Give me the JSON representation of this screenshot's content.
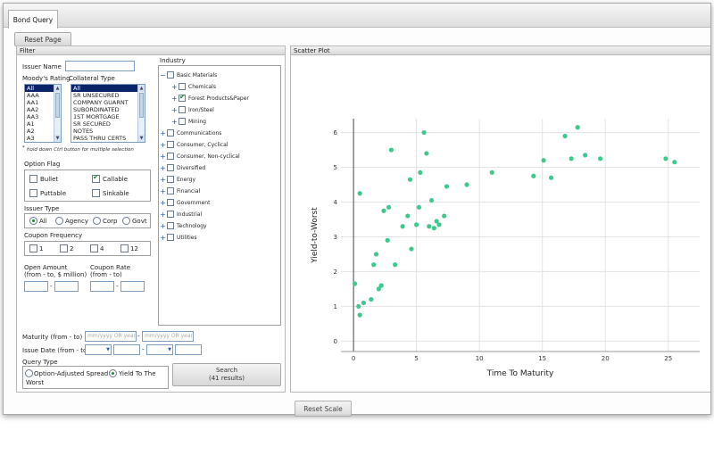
{
  "tabs": [
    {
      "label": "Bond Query"
    }
  ],
  "reset_page_label": "Reset Page",
  "filter": {
    "title": "Filter",
    "issuer_name_label": "Issuer Name",
    "moodys_label": "Moody's Rating",
    "moodys_options": [
      "All",
      "AAA",
      "AA1",
      "AA2",
      "AA3",
      "A1",
      "A2",
      "A3"
    ],
    "collateral_label": "Collateral Type",
    "collateral_options": [
      "All",
      "SR UNSECURED",
      "COMPANY GUARNT",
      "SUBORDINATED",
      "1ST MORTGAGE",
      "SR SECURED",
      "NOTES",
      "PASS THRU CERTS"
    ],
    "hint_mark": "*",
    "hint": "hold down Ctrl button for multiple selection",
    "option_flag_label": "Option Flag",
    "option_flags": [
      {
        "label": "Bullet",
        "checked": false
      },
      {
        "label": "Callable",
        "checked": true
      },
      {
        "label": "Puttable",
        "checked": false
      },
      {
        "label": "Sinkable",
        "checked": false
      }
    ],
    "issuer_type_label": "Issuer Type",
    "issuer_types": [
      {
        "label": "All",
        "selected": true
      },
      {
        "label": "Agency",
        "selected": false
      },
      {
        "label": "Corp",
        "selected": false
      },
      {
        "label": "Govt",
        "selected": false
      }
    ],
    "coupon_freq_label": "Coupon Frequency",
    "coupon_freqs": [
      "1",
      "2",
      "4",
      "12"
    ],
    "open_amount_label1": "Open Amount",
    "open_amount_label2": "(from - to, $ million)",
    "coupon_rate_label1": "Coupon Rate",
    "coupon_rate_label2": "(from - to)",
    "range_dash": "-",
    "maturity_label": "Maturity (from - to)",
    "date_placeholder": "mm/yyyy OR year",
    "issue_date_label": "Issue Date (from - to)",
    "query_type_label": "Query Type",
    "query_types": [
      {
        "label": "Option-Adjusted Spread",
        "selected": false
      },
      {
        "label": "Yield To The",
        "selected": true
      }
    ],
    "query_type_wrap": "Worst",
    "search_label": "Search",
    "search_results": "(41 results)"
  },
  "industry": {
    "label": "Industry",
    "items": [
      {
        "label": "Basic Materials",
        "expander": "−",
        "level": 0,
        "checked": false
      },
      {
        "label": "Chemicals",
        "expander": "+",
        "level": 1,
        "checked": false
      },
      {
        "label": "Forest Products&Paper",
        "expander": "+",
        "level": 1,
        "checked": true
      },
      {
        "label": "Iron/Steel",
        "expander": "+",
        "level": 1,
        "checked": false
      },
      {
        "label": "Mining",
        "expander": "+",
        "level": 1,
        "checked": false
      },
      {
        "label": "Communications",
        "expander": "+",
        "level": 0,
        "checked": false
      },
      {
        "label": "Consumer, Cyclical",
        "expander": "+",
        "level": 0,
        "checked": false
      },
      {
        "label": "Consumer, Non-cyclical",
        "expander": "+",
        "level": 0,
        "checked": false
      },
      {
        "label": "Diversified",
        "expander": "+",
        "level": 0,
        "checked": false
      },
      {
        "label": "Energy",
        "expander": "+",
        "level": 0,
        "checked": false
      },
      {
        "label": "Financial",
        "expander": "+",
        "level": 0,
        "checked": false
      },
      {
        "label": "Government",
        "expander": "+",
        "level": 0,
        "checked": false
      },
      {
        "label": "Industrial",
        "expander": "+",
        "level": 0,
        "checked": false
      },
      {
        "label": "Technology",
        "expander": "+",
        "level": 0,
        "checked": false
      },
      {
        "label": "Utilities",
        "expander": "+",
        "level": 0,
        "checked": false
      }
    ]
  },
  "scatter": {
    "title": "Scatter Plot",
    "reset_scale_label": "Reset Scale"
  },
  "colors": {
    "point": "#3cc98b",
    "accent_check": "#1c8a2c"
  },
  "chart_data": {
    "type": "scatter",
    "title": "",
    "xlabel": "Time To Maturity",
    "ylabel": "Yield-to-Worst",
    "xlim": [
      -1,
      27.5
    ],
    "ylim": [
      -0.3,
      6.4
    ],
    "xticks": [
      0,
      5,
      10,
      15,
      20,
      25
    ],
    "yticks": [
      0,
      1,
      2,
      3,
      4,
      5,
      6
    ],
    "grid": true,
    "series": [
      {
        "x": [
          0.1,
          0.4,
          0.5,
          0.5,
          0.8,
          1.4,
          1.6,
          1.8,
          2.0,
          2.2,
          2.4,
          2.7,
          2.8,
          3.0,
          3.3,
          3.9,
          4.3,
          4.5,
          4.6,
          5.0,
          5.2,
          5.3,
          5.6,
          5.8,
          6.0,
          6.2,
          6.4,
          6.6,
          6.8,
          7.2,
          7.4,
          9.0,
          11.0,
          14.3,
          15.1,
          15.7,
          16.8,
          17.3,
          17.8,
          18.4,
          19.6,
          24.8,
          25.5
        ],
        "y": [
          1.65,
          1.0,
          0.75,
          4.25,
          1.1,
          1.2,
          2.2,
          2.5,
          1.5,
          1.6,
          3.75,
          2.9,
          3.85,
          5.5,
          2.2,
          3.3,
          3.6,
          4.65,
          2.65,
          3.35,
          3.85,
          4.85,
          6.0,
          5.4,
          3.3,
          4.05,
          3.25,
          3.45,
          3.35,
          3.6,
          4.45,
          4.5,
          4.85,
          4.75,
          5.2,
          4.7,
          5.9,
          5.25,
          6.15,
          5.35,
          5.25,
          5.25,
          5.15
        ]
      }
    ]
  }
}
